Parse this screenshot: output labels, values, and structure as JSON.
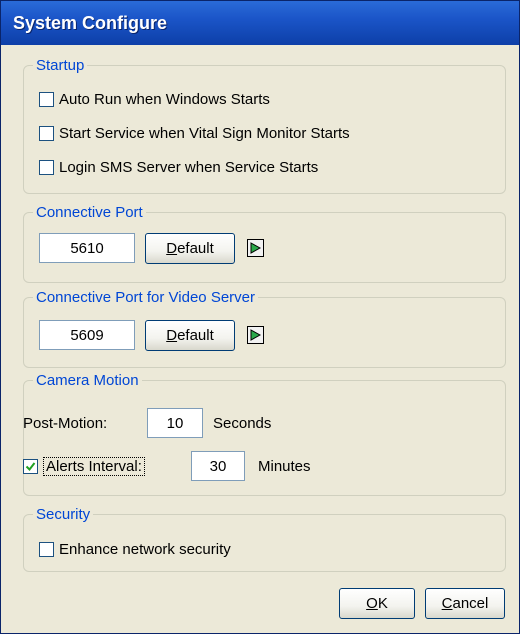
{
  "window": {
    "title": "System Configure"
  },
  "startup": {
    "legend": "Startup",
    "options": [
      {
        "label": "Auto Run when Windows Starts",
        "checked": false
      },
      {
        "label": "Start Service when Vital Sign Monitor Starts",
        "checked": false
      },
      {
        "label": "Login SMS Server when Service Starts",
        "checked": false
      }
    ]
  },
  "connective_port": {
    "legend": "Connective Port",
    "value": "5610",
    "default_label": "Default",
    "default_mnemonic": "D"
  },
  "video_port": {
    "legend": "Connective Port for Video Server",
    "value": "5609",
    "default_label": "Default",
    "default_mnemonic": "D"
  },
  "camera_motion": {
    "legend": "Camera Motion",
    "post_motion_label": "Post-Motion:",
    "post_motion_value": "10",
    "post_motion_unit": "Seconds",
    "alerts_label": "Alerts Interval:",
    "alerts_checked": true,
    "alerts_value": "30",
    "alerts_unit": "Minutes"
  },
  "security": {
    "legend": "Security",
    "option": {
      "label": "Enhance network security",
      "checked": false
    }
  },
  "footer": {
    "ok_label": "OK",
    "cancel_label": "Cancel"
  },
  "colors": {
    "titlebar": "#1b55c8",
    "legend": "#0046d5",
    "background": "#ece9d8",
    "play_arrow": "#2aa84a"
  },
  "icons": {
    "play": "play-arrow-icon",
    "check": "checkmark-icon"
  }
}
